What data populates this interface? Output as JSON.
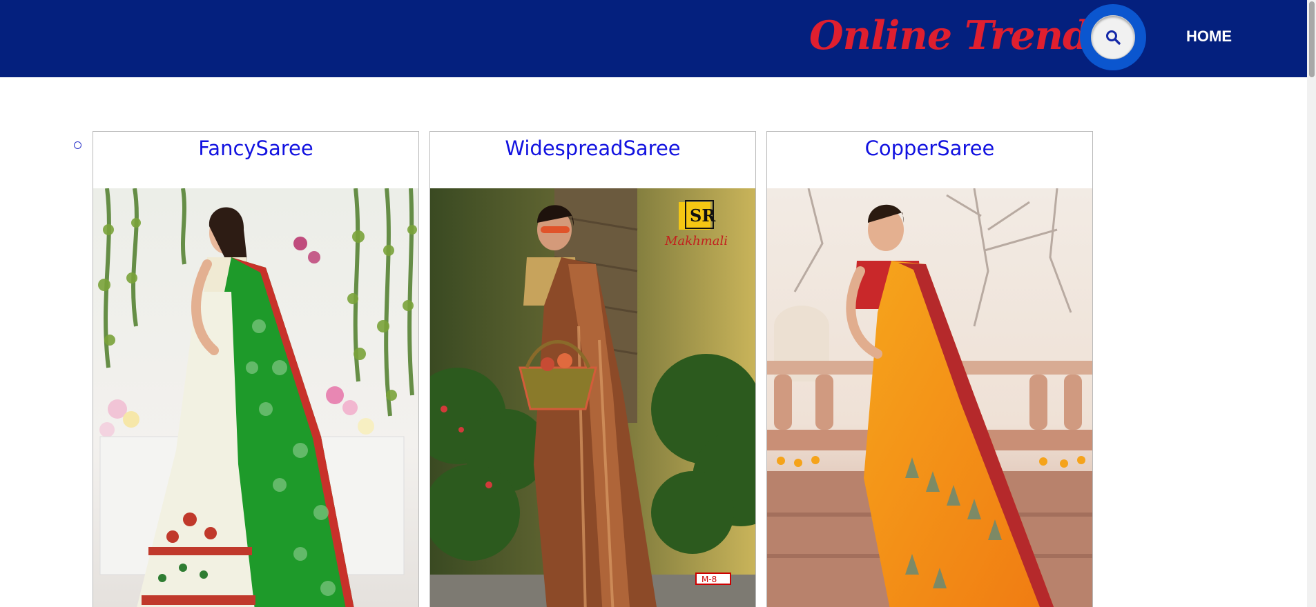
{
  "header": {
    "brand": "Online Trends",
    "nav": {
      "home": "HOME"
    },
    "search_icon": "search-icon"
  },
  "colors": {
    "header_bg": "#04207e",
    "brand_red": "#df1f2f",
    "title_blue": "#1212e0"
  },
  "products": [
    {
      "name": "FancySaree",
      "image": "green saree"
    },
    {
      "name": "WidespreadSaree",
      "image": "brown saree",
      "watermark_brand": "Makhmali",
      "watermark_logo": "SR",
      "tag": "M-8"
    },
    {
      "name": "CopperSaree",
      "image": "orange saree"
    }
  ]
}
